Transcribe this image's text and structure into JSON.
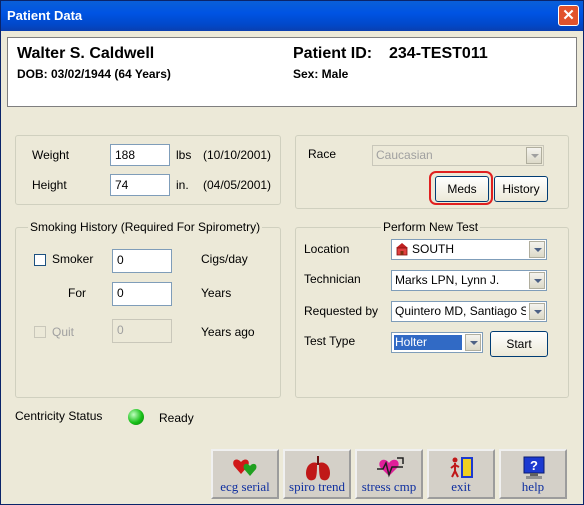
{
  "window": {
    "title": "Patient Data",
    "close": "✕"
  },
  "patient": {
    "name": "Walter S. Caldwell",
    "dob": "DOB:  03/02/1944 (64 Years)",
    "id_label": "Patient ID:",
    "id_value": "234-TEST011",
    "sex": "Sex: Male"
  },
  "measurements": {
    "weight_label": "Weight",
    "weight_value": "188",
    "weight_unit": "lbs",
    "weight_date": "(10/10/2001)",
    "height_label": "Height",
    "height_value": "74",
    "height_unit": "in.",
    "height_date": "(04/05/2001)"
  },
  "race": {
    "label": "Race",
    "value": "Caucasian"
  },
  "buttons": {
    "meds": "Meds",
    "history": "History",
    "start": "Start"
  },
  "smoking": {
    "title": "Smoking History (Required For Spirometry)",
    "smoker_label": "Smoker",
    "cigs_value": "0",
    "cigs_unit": "Cigs/day",
    "for_label": "For",
    "years_value": "0",
    "years_unit": "Years",
    "quit_label": "Quit",
    "quit_value": "0",
    "quit_unit": "Years ago"
  },
  "new_test": {
    "title": "Perform New Test",
    "location_label": "Location",
    "location_value": "SOUTH",
    "technician_label": "Technician",
    "technician_value": "Marks LPN, Lynn J.",
    "requested_label": "Requested by",
    "requested_value": "Quintero MD, Santiago S",
    "testtype_label": "Test Type",
    "testtype_value": "Holter"
  },
  "status": {
    "label": "Centricity Status",
    "value": "Ready",
    "color": "#18c018"
  },
  "toolbar": [
    {
      "label": "ecg serial",
      "icon": "ecg-serial-icon"
    },
    {
      "label": "spiro trend",
      "icon": "spiro-trend-icon"
    },
    {
      "label": "stress cmp",
      "icon": "stress-cmp-icon"
    },
    {
      "label": "exit",
      "icon": "exit-icon"
    },
    {
      "label": "help",
      "icon": "help-icon"
    }
  ]
}
